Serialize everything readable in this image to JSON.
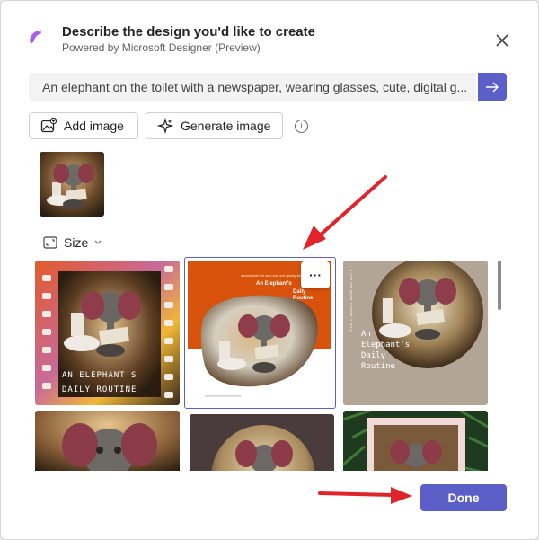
{
  "header": {
    "title": "Describe the design you'd like to create",
    "subtitle": "Powered by Microsoft Designer (Preview)",
    "app_icon": "designer-logo-icon",
    "close_icon": "close-icon"
  },
  "prompt": {
    "value": "An elephant on the toilet with a newspaper, wearing glasses, cute, digital g...",
    "send_icon": "arrow-right-icon"
  },
  "actions": {
    "add_image_label": "Add image",
    "generate_image_label": "Generate image",
    "info_icon": "info-icon"
  },
  "size": {
    "label": "Size"
  },
  "designs": {
    "cards": [
      {
        "id": "film-strip",
        "lines": [
          "AN ELEPHANT'S",
          "DAILY ROUTINE"
        ]
      },
      {
        "id": "orange-blob",
        "selected": true,
        "small_caption": "a somewhat ride on a cute and spunky elephant",
        "title_lines": [
          "An Elephant's",
          "Daily",
          "Routine"
        ]
      },
      {
        "id": "tan-circle",
        "vertical_caption": "a cute and spunky elephant's daily",
        "lines": [
          "An",
          "Elephant's",
          "Daily",
          "Routine"
        ]
      },
      {
        "id": "portrait-full"
      },
      {
        "id": "dark-circle"
      },
      {
        "id": "green-frame"
      }
    ],
    "more_options_label": "···"
  },
  "footer": {
    "done_label": "Done"
  },
  "colors": {
    "accent": "#5b5fc7",
    "annotation_arrow": "#e0242c",
    "orange": "#d8520b",
    "tan": "#b3a595"
  }
}
